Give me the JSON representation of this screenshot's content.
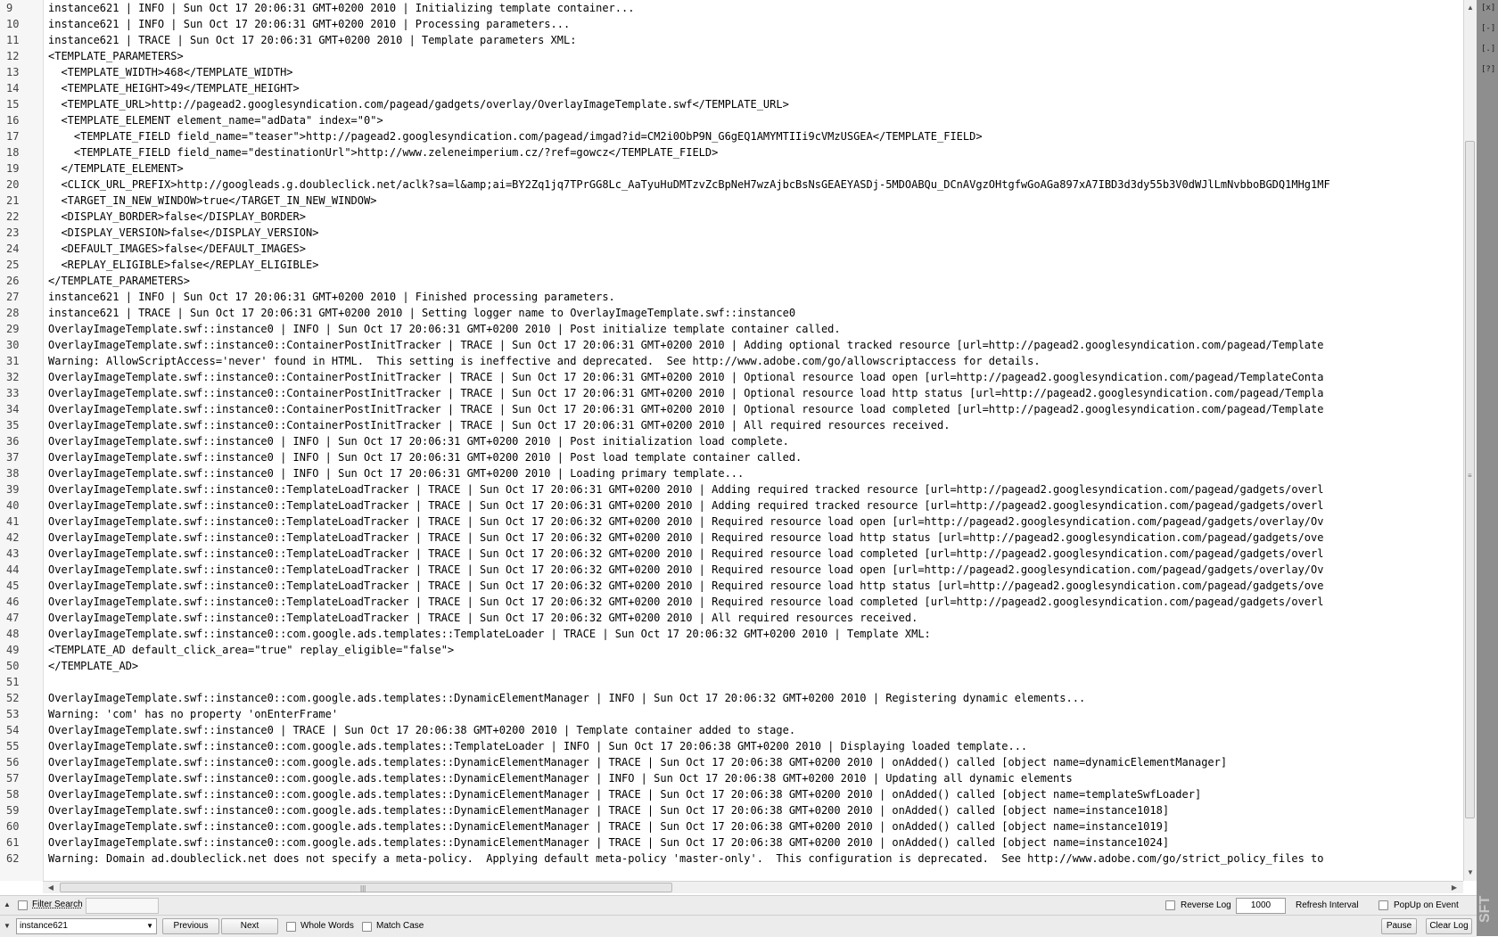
{
  "log": {
    "lines": [
      {
        "num": "9",
        "text": "instance621 | INFO | Sun Oct 17 20:06:31 GMT+0200 2010 | Initializing template container..."
      },
      {
        "num": "10",
        "text": "instance621 | INFO | Sun Oct 17 20:06:31 GMT+0200 2010 | Processing parameters..."
      },
      {
        "num": "11",
        "text": "instance621 | TRACE | Sun Oct 17 20:06:31 GMT+0200 2010 | Template parameters XML:"
      },
      {
        "num": "12",
        "text": "<TEMPLATE_PARAMETERS>"
      },
      {
        "num": "13",
        "text": "  <TEMPLATE_WIDTH>468</TEMPLATE_WIDTH>"
      },
      {
        "num": "14",
        "text": "  <TEMPLATE_HEIGHT>49</TEMPLATE_HEIGHT>"
      },
      {
        "num": "15",
        "text": "  <TEMPLATE_URL>http://pagead2.googlesyndication.com/pagead/gadgets/overlay/OverlayImageTemplate.swf</TEMPLATE_URL>"
      },
      {
        "num": "16",
        "text": "  <TEMPLATE_ELEMENT element_name=\"adData\" index=\"0\">"
      },
      {
        "num": "17",
        "text": "    <TEMPLATE_FIELD field_name=\"teaser\">http://pagead2.googlesyndication.com/pagead/imgad?id=CM2i0ObP9N_G6gEQ1AMYMTIIi9cVMzUSGEA</TEMPLATE_FIELD>"
      },
      {
        "num": "18",
        "text": "    <TEMPLATE_FIELD field_name=\"destinationUrl\">http://www.zeleneimperium.cz/?ref=gowcz</TEMPLATE_FIELD>"
      },
      {
        "num": "19",
        "text": "  </TEMPLATE_ELEMENT>"
      },
      {
        "num": "20",
        "text": "  <CLICK_URL_PREFIX>http://googleads.g.doubleclick.net/aclk?sa=l&amp;ai=BY2Zq1jq7TPrGG8Lc_AaTyuHuDMTzvZcBpNeH7wzAjbcBsNsGEAEYASDj-5MDOABQu_DCnAVgzOHtgfwGoAGa897xA7IBD3d3dy55b3V0dWJlLmNvbboBGDQ1MHg1MF"
      },
      {
        "num": "21",
        "text": "  <TARGET_IN_NEW_WINDOW>true</TARGET_IN_NEW_WINDOW>"
      },
      {
        "num": "22",
        "text": "  <DISPLAY_BORDER>false</DISPLAY_BORDER>"
      },
      {
        "num": "23",
        "text": "  <DISPLAY_VERSION>false</DISPLAY_VERSION>"
      },
      {
        "num": "24",
        "text": "  <DEFAULT_IMAGES>false</DEFAULT_IMAGES>"
      },
      {
        "num": "25",
        "text": "  <REPLAY_ELIGIBLE>false</REPLAY_ELIGIBLE>"
      },
      {
        "num": "26",
        "text": "</TEMPLATE_PARAMETERS>"
      },
      {
        "num": "27",
        "text": "instance621 | INFO | Sun Oct 17 20:06:31 GMT+0200 2010 | Finished processing parameters."
      },
      {
        "num": "28",
        "text": "instance621 | TRACE | Sun Oct 17 20:06:31 GMT+0200 2010 | Setting logger name to OverlayImageTemplate.swf::instance0"
      },
      {
        "num": "29",
        "text": "OverlayImageTemplate.swf::instance0 | INFO | Sun Oct 17 20:06:31 GMT+0200 2010 | Post initialize template container called."
      },
      {
        "num": "30",
        "text": "OverlayImageTemplate.swf::instance0::ContainerPostInitTracker | TRACE | Sun Oct 17 20:06:31 GMT+0200 2010 | Adding optional tracked resource [url=http://pagead2.googlesyndication.com/pagead/Template"
      },
      {
        "num": "31",
        "text": "Warning: AllowScriptAccess='never' found in HTML.  This setting is ineffective and deprecated.  See http://www.adobe.com/go/allowscriptaccess for details."
      },
      {
        "num": "32",
        "text": "OverlayImageTemplate.swf::instance0::ContainerPostInitTracker | TRACE | Sun Oct 17 20:06:31 GMT+0200 2010 | Optional resource load open [url=http://pagead2.googlesyndication.com/pagead/TemplateConta"
      },
      {
        "num": "33",
        "text": "OverlayImageTemplate.swf::instance0::ContainerPostInitTracker | TRACE | Sun Oct 17 20:06:31 GMT+0200 2010 | Optional resource load http status [url=http://pagead2.googlesyndication.com/pagead/Templa"
      },
      {
        "num": "34",
        "text": "OverlayImageTemplate.swf::instance0::ContainerPostInitTracker | TRACE | Sun Oct 17 20:06:31 GMT+0200 2010 | Optional resource load completed [url=http://pagead2.googlesyndication.com/pagead/Template"
      },
      {
        "num": "35",
        "text": "OverlayImageTemplate.swf::instance0::ContainerPostInitTracker | TRACE | Sun Oct 17 20:06:31 GMT+0200 2010 | All required resources received."
      },
      {
        "num": "36",
        "text": "OverlayImageTemplate.swf::instance0 | INFO | Sun Oct 17 20:06:31 GMT+0200 2010 | Post initialization load complete."
      },
      {
        "num": "37",
        "text": "OverlayImageTemplate.swf::instance0 | INFO | Sun Oct 17 20:06:31 GMT+0200 2010 | Post load template container called."
      },
      {
        "num": "38",
        "text": "OverlayImageTemplate.swf::instance0 | INFO | Sun Oct 17 20:06:31 GMT+0200 2010 | Loading primary template..."
      },
      {
        "num": "39",
        "text": "OverlayImageTemplate.swf::instance0::TemplateLoadTracker | TRACE | Sun Oct 17 20:06:31 GMT+0200 2010 | Adding required tracked resource [url=http://pagead2.googlesyndication.com/pagead/gadgets/overl"
      },
      {
        "num": "40",
        "text": "OverlayImageTemplate.swf::instance0::TemplateLoadTracker | TRACE | Sun Oct 17 20:06:31 GMT+0200 2010 | Adding required tracked resource [url=http://pagead2.googlesyndication.com/pagead/gadgets/overl"
      },
      {
        "num": "41",
        "text": "OverlayImageTemplate.swf::instance0::TemplateLoadTracker | TRACE | Sun Oct 17 20:06:32 GMT+0200 2010 | Required resource load open [url=http://pagead2.googlesyndication.com/pagead/gadgets/overlay/Ov"
      },
      {
        "num": "42",
        "text": "OverlayImageTemplate.swf::instance0::TemplateLoadTracker | TRACE | Sun Oct 17 20:06:32 GMT+0200 2010 | Required resource load http status [url=http://pagead2.googlesyndication.com/pagead/gadgets/ove"
      },
      {
        "num": "43",
        "text": "OverlayImageTemplate.swf::instance0::TemplateLoadTracker | TRACE | Sun Oct 17 20:06:32 GMT+0200 2010 | Required resource load completed [url=http://pagead2.googlesyndication.com/pagead/gadgets/overl"
      },
      {
        "num": "44",
        "text": "OverlayImageTemplate.swf::instance0::TemplateLoadTracker | TRACE | Sun Oct 17 20:06:32 GMT+0200 2010 | Required resource load open [url=http://pagead2.googlesyndication.com/pagead/gadgets/overlay/Ov"
      },
      {
        "num": "45",
        "text": "OverlayImageTemplate.swf::instance0::TemplateLoadTracker | TRACE | Sun Oct 17 20:06:32 GMT+0200 2010 | Required resource load http status [url=http://pagead2.googlesyndication.com/pagead/gadgets/ove"
      },
      {
        "num": "46",
        "text": "OverlayImageTemplate.swf::instance0::TemplateLoadTracker | TRACE | Sun Oct 17 20:06:32 GMT+0200 2010 | Required resource load completed [url=http://pagead2.googlesyndication.com/pagead/gadgets/overl"
      },
      {
        "num": "47",
        "text": "OverlayImageTemplate.swf::instance0::TemplateLoadTracker | TRACE | Sun Oct 17 20:06:32 GMT+0200 2010 | All required resources received."
      },
      {
        "num": "48",
        "text": "OverlayImageTemplate.swf::instance0::com.google.ads.templates::TemplateLoader | TRACE | Sun Oct 17 20:06:32 GMT+0200 2010 | Template XML:"
      },
      {
        "num": "49",
        "text": "<TEMPLATE_AD default_click_area=\"true\" replay_eligible=\"false\">"
      },
      {
        "num": "50",
        "text": "</TEMPLATE_AD>"
      },
      {
        "num": "51",
        "text": ""
      },
      {
        "num": "52",
        "text": "OverlayImageTemplate.swf::instance0::com.google.ads.templates::DynamicElementManager | INFO | Sun Oct 17 20:06:32 GMT+0200 2010 | Registering dynamic elements..."
      },
      {
        "num": "53",
        "text": "Warning: 'com' has no property 'onEnterFrame'"
      },
      {
        "num": "54",
        "text": "OverlayImageTemplate.swf::instance0 | TRACE | Sun Oct 17 20:06:38 GMT+0200 2010 | Template container added to stage."
      },
      {
        "num": "55",
        "text": "OverlayImageTemplate.swf::instance0::com.google.ads.templates::TemplateLoader | INFO | Sun Oct 17 20:06:38 GMT+0200 2010 | Displaying loaded template..."
      },
      {
        "num": "56",
        "text": "OverlayImageTemplate.swf::instance0::com.google.ads.templates::DynamicElementManager | TRACE | Sun Oct 17 20:06:38 GMT+0200 2010 | onAdded() called [object name=dynamicElementManager]"
      },
      {
        "num": "57",
        "text": "OverlayImageTemplate.swf::instance0::com.google.ads.templates::DynamicElementManager | INFO | Sun Oct 17 20:06:38 GMT+0200 2010 | Updating all dynamic elements"
      },
      {
        "num": "58",
        "text": "OverlayImageTemplate.swf::instance0::com.google.ads.templates::DynamicElementManager | TRACE | Sun Oct 17 20:06:38 GMT+0200 2010 | onAdded() called [object name=templateSwfLoader]"
      },
      {
        "num": "59",
        "text": "OverlayImageTemplate.swf::instance0::com.google.ads.templates::DynamicElementManager | TRACE | Sun Oct 17 20:06:38 GMT+0200 2010 | onAdded() called [object name=instance1018]"
      },
      {
        "num": "60",
        "text": "OverlayImageTemplate.swf::instance0::com.google.ads.templates::DynamicElementManager | TRACE | Sun Oct 17 20:06:38 GMT+0200 2010 | onAdded() called [object name=instance1019]"
      },
      {
        "num": "61",
        "text": "OverlayImageTemplate.swf::instance0::com.google.ads.templates::DynamicElementManager | TRACE | Sun Oct 17 20:06:38 GMT+0200 2010 | onAdded() called [object name=instance1024]"
      },
      {
        "num": "62",
        "text": "Warning: Domain ad.doubleclick.net does not specify a meta-policy.  Applying default meta-policy 'master-only'.  This configuration is deprecated.  See http://www.adobe.com/go/strict_policy_files to"
      }
    ]
  },
  "side_panel": {
    "buttons": [
      "[x]",
      "[-]",
      "[.]",
      "[?]"
    ],
    "logo": "SFT"
  },
  "toolbar_top": {
    "filter_search_label": "Filter Search",
    "reverse_log_label": "Reverse Log",
    "refresh_interval_value": "1000",
    "refresh_interval_label": "Refresh Interval",
    "popup_on_event_label": "PopUp on Event"
  },
  "toolbar_bottom": {
    "search_value": "instance621",
    "previous_label": "Previous",
    "next_label": "Next",
    "whole_words_label": "Whole Words",
    "match_case_label": "Match Case",
    "pause_label": "Pause",
    "clear_log_label": "Clear Log"
  },
  "icons": {
    "scroll_up": "scroll-up-arrow",
    "scroll_down": "scroll-down-arrow",
    "scroll_left": "scroll-left-arrow",
    "scroll_right": "scroll-right-arrow",
    "dropdown": "chevron-down"
  }
}
